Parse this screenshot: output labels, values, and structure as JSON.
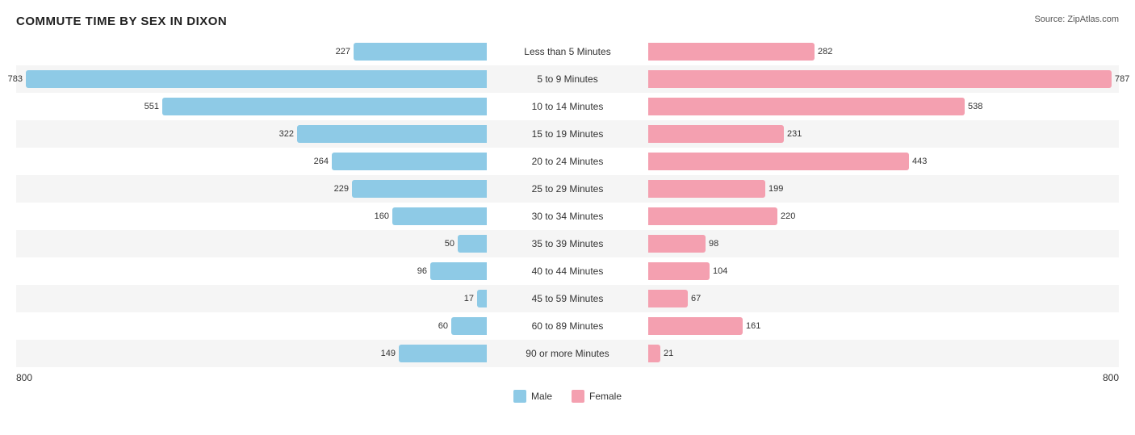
{
  "title": "COMMUTE TIME BY SEX IN DIXON",
  "source": "Source: ZipAtlas.com",
  "axis": {
    "left": "800",
    "right": "800"
  },
  "legend": {
    "male_label": "Male",
    "female_label": "Female",
    "male_color": "#8ecae6",
    "female_color": "#f4a0b0"
  },
  "rows": [
    {
      "label": "Less than 5 Minutes",
      "male": 227,
      "female": 282,
      "alt": false
    },
    {
      "label": "5 to 9 Minutes",
      "male": 783,
      "female": 787,
      "alt": true
    },
    {
      "label": "10 to 14 Minutes",
      "male": 551,
      "female": 538,
      "alt": false
    },
    {
      "label": "15 to 19 Minutes",
      "male": 322,
      "female": 231,
      "alt": true
    },
    {
      "label": "20 to 24 Minutes",
      "male": 264,
      "female": 443,
      "alt": false
    },
    {
      "label": "25 to 29 Minutes",
      "male": 229,
      "female": 199,
      "alt": true
    },
    {
      "label": "30 to 34 Minutes",
      "male": 160,
      "female": 220,
      "alt": false
    },
    {
      "label": "35 to 39 Minutes",
      "male": 50,
      "female": 98,
      "alt": true
    },
    {
      "label": "40 to 44 Minutes",
      "male": 96,
      "female": 104,
      "alt": false
    },
    {
      "label": "45 to 59 Minutes",
      "male": 17,
      "female": 67,
      "alt": true
    },
    {
      "label": "60 to 89 Minutes",
      "male": 60,
      "female": 161,
      "alt": false
    },
    {
      "label": "90 or more Minutes",
      "male": 149,
      "female": 21,
      "alt": true
    }
  ],
  "max_value": 800
}
